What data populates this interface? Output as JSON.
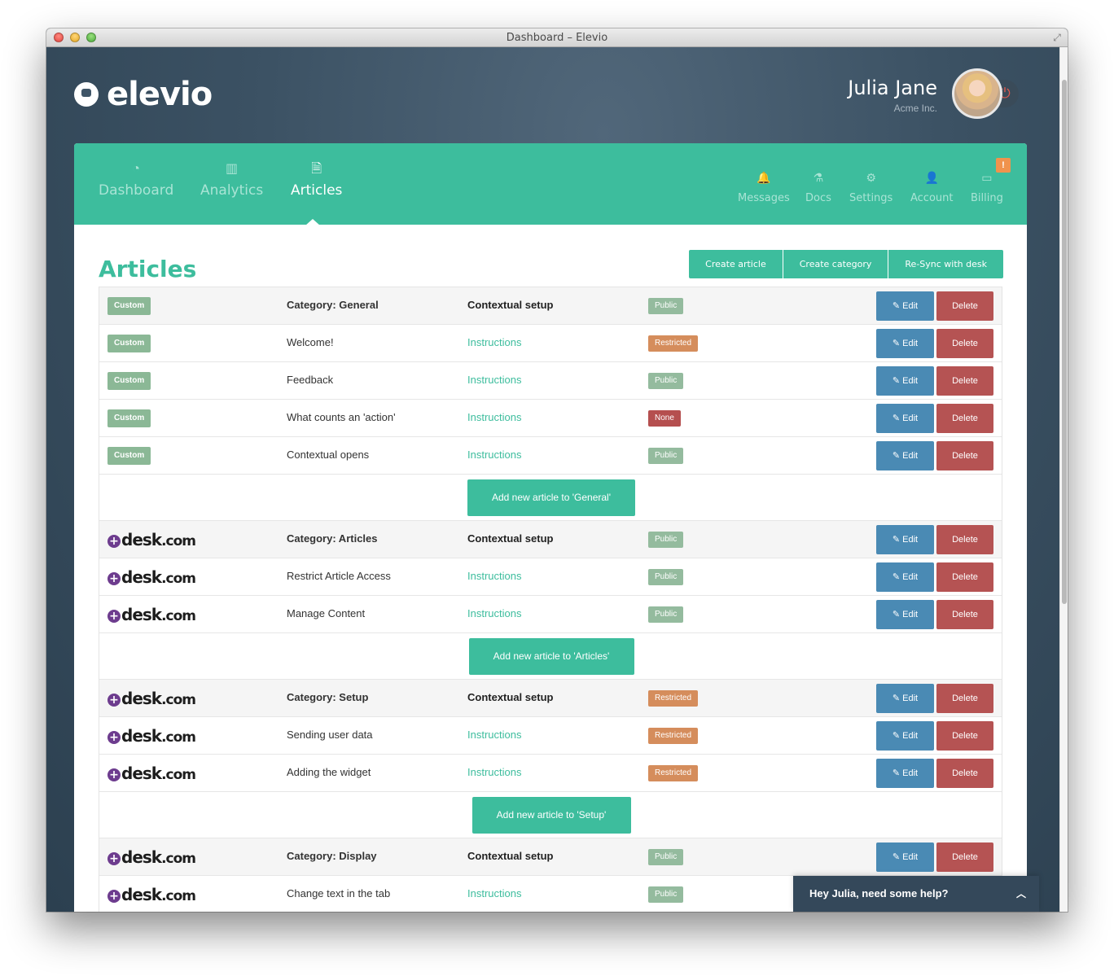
{
  "window": {
    "title": "Dashboard – Elevio"
  },
  "brand": {
    "logo_text": "elevio"
  },
  "user": {
    "name": "Julia Jane",
    "company": "Acme Inc."
  },
  "nav": {
    "main": [
      {
        "label": "Dashboard",
        "icon": "dashboard-gauge-icon"
      },
      {
        "label": "Analytics",
        "icon": "bar-chart-icon"
      },
      {
        "label": "Articles",
        "icon": "document-icon",
        "active": true
      }
    ],
    "secondary": [
      {
        "label": "Messages",
        "icon": "bell-icon"
      },
      {
        "label": "Docs",
        "icon": "flask-icon"
      },
      {
        "label": "Settings",
        "icon": "gear-icon"
      },
      {
        "label": "Account",
        "icon": "user-icon"
      },
      {
        "label": "Billing",
        "icon": "credit-card-icon"
      }
    ],
    "billing_alert": "!"
  },
  "page": {
    "title": "Articles",
    "actions": [
      "Create article",
      "Create category",
      "Re-Sync with desk"
    ]
  },
  "table": {
    "edit_label": "Edit",
    "delete_label": "Delete",
    "instructions_label": "Instructions",
    "contextual_setup_label": "Contextual setup",
    "custom_label": "Custom",
    "desk_label": {
      "prefix": "desk",
      "suffix": ".com"
    },
    "rows": [
      {
        "type": "category",
        "source": "custom",
        "name": "Category: General",
        "status": "Public"
      },
      {
        "type": "article",
        "source": "custom",
        "name": "Welcome!",
        "status": "Restricted"
      },
      {
        "type": "article",
        "source": "custom",
        "name": "Feedback",
        "status": "Public"
      },
      {
        "type": "article",
        "source": "custom",
        "name": "What counts an 'action'",
        "status": "None"
      },
      {
        "type": "article",
        "source": "custom",
        "name": "Contextual opens",
        "status": "Public"
      },
      {
        "type": "add",
        "label": "Add new article to 'General'"
      },
      {
        "type": "category",
        "source": "desk",
        "name": "Category: Articles",
        "status": "Public"
      },
      {
        "type": "article",
        "source": "desk",
        "name": "Restrict Article Access",
        "status": "Public"
      },
      {
        "type": "article",
        "source": "desk",
        "name": "Manage Content",
        "status": "Public"
      },
      {
        "type": "add",
        "label": "Add new article to 'Articles'"
      },
      {
        "type": "category",
        "source": "desk",
        "name": "Category: Setup",
        "status": "Restricted"
      },
      {
        "type": "article",
        "source": "desk",
        "name": "Sending user data",
        "status": "Restricted"
      },
      {
        "type": "article",
        "source": "desk",
        "name": "Adding the widget",
        "status": "Restricted"
      },
      {
        "type": "add",
        "label": "Add new article to 'Setup'"
      },
      {
        "type": "category",
        "source": "desk",
        "name": "Category: Display",
        "status": "Public"
      },
      {
        "type": "article",
        "source": "desk",
        "name": "Change text in the tab",
        "status": "Public"
      }
    ]
  },
  "help_widget": {
    "label": "Hey Julia, need some help?"
  },
  "colors": {
    "accent": "#3dbd9d",
    "edit": "#4a8ab4",
    "delete": "#b55353",
    "public": "#94bb9e",
    "restricted": "#d58d5c",
    "none": "#b54f4f"
  }
}
